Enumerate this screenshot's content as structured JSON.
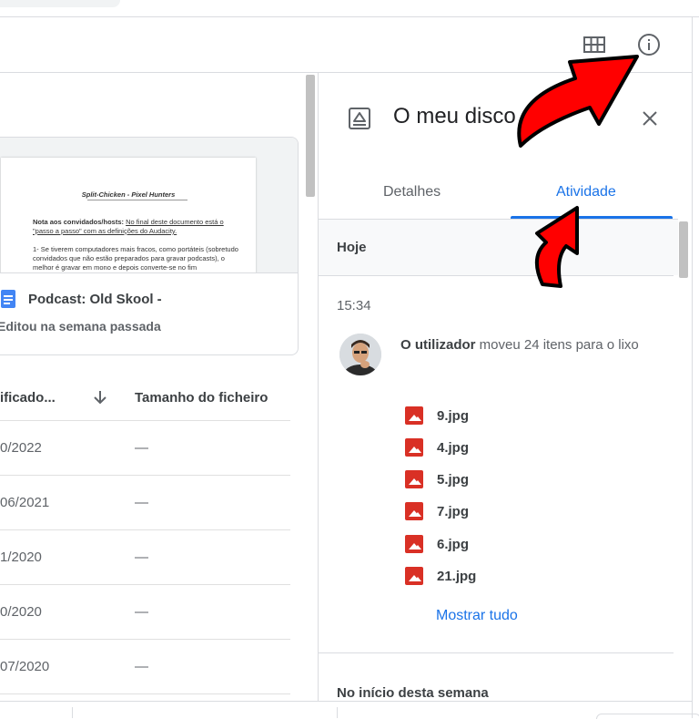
{
  "panel": {
    "title": "O meu disco",
    "tabs": [
      "Detalhes",
      "Atividade"
    ],
    "active_tab": "Atividade",
    "section_today": "Hoje",
    "time": "15:34",
    "actor": "O utilizador",
    "action_text": "moveu 24 itens para o lixo",
    "files": [
      "9.jpg",
      "4.jpg",
      "5.jpg",
      "7.jpg",
      "6.jpg",
      "21.jpg"
    ],
    "show_all": "Mostrar tudo",
    "section_week": "No início desta semana"
  },
  "card": {
    "name": "Podcast: Old Skool -",
    "subtitle": "Editou na semana passada",
    "doc_title": "Split-Chicken - Pixel Hunters",
    "doc_note_bold": "Nota aos convidados/hosts:",
    "doc_note_rest": "No final deste documento está o \"passo a passo\" com as definições do Audacity.",
    "doc_para": "1- Se tiverem computadores mais fracos, como portáteis (sobretudo convidados que não estão preparados para gravar podcasts), o melhor é gravar em mono e depois converte-se no fim"
  },
  "table": {
    "col_modified": "ificado...",
    "col_size": "Tamanho do ficheiro",
    "rows": [
      {
        "date": "0/2022",
        "size": "—"
      },
      {
        "date": "06/2021",
        "size": "—"
      },
      {
        "date": "1/2020",
        "size": "—"
      },
      {
        "date": "0/2020",
        "size": "—"
      },
      {
        "date": "07/2020",
        "size": "—"
      }
    ]
  },
  "colors": {
    "accent": "#1a73e8",
    "arrow": "#ff0000",
    "file_icon": "#d93025",
    "doc_icon": "#4285f4"
  }
}
